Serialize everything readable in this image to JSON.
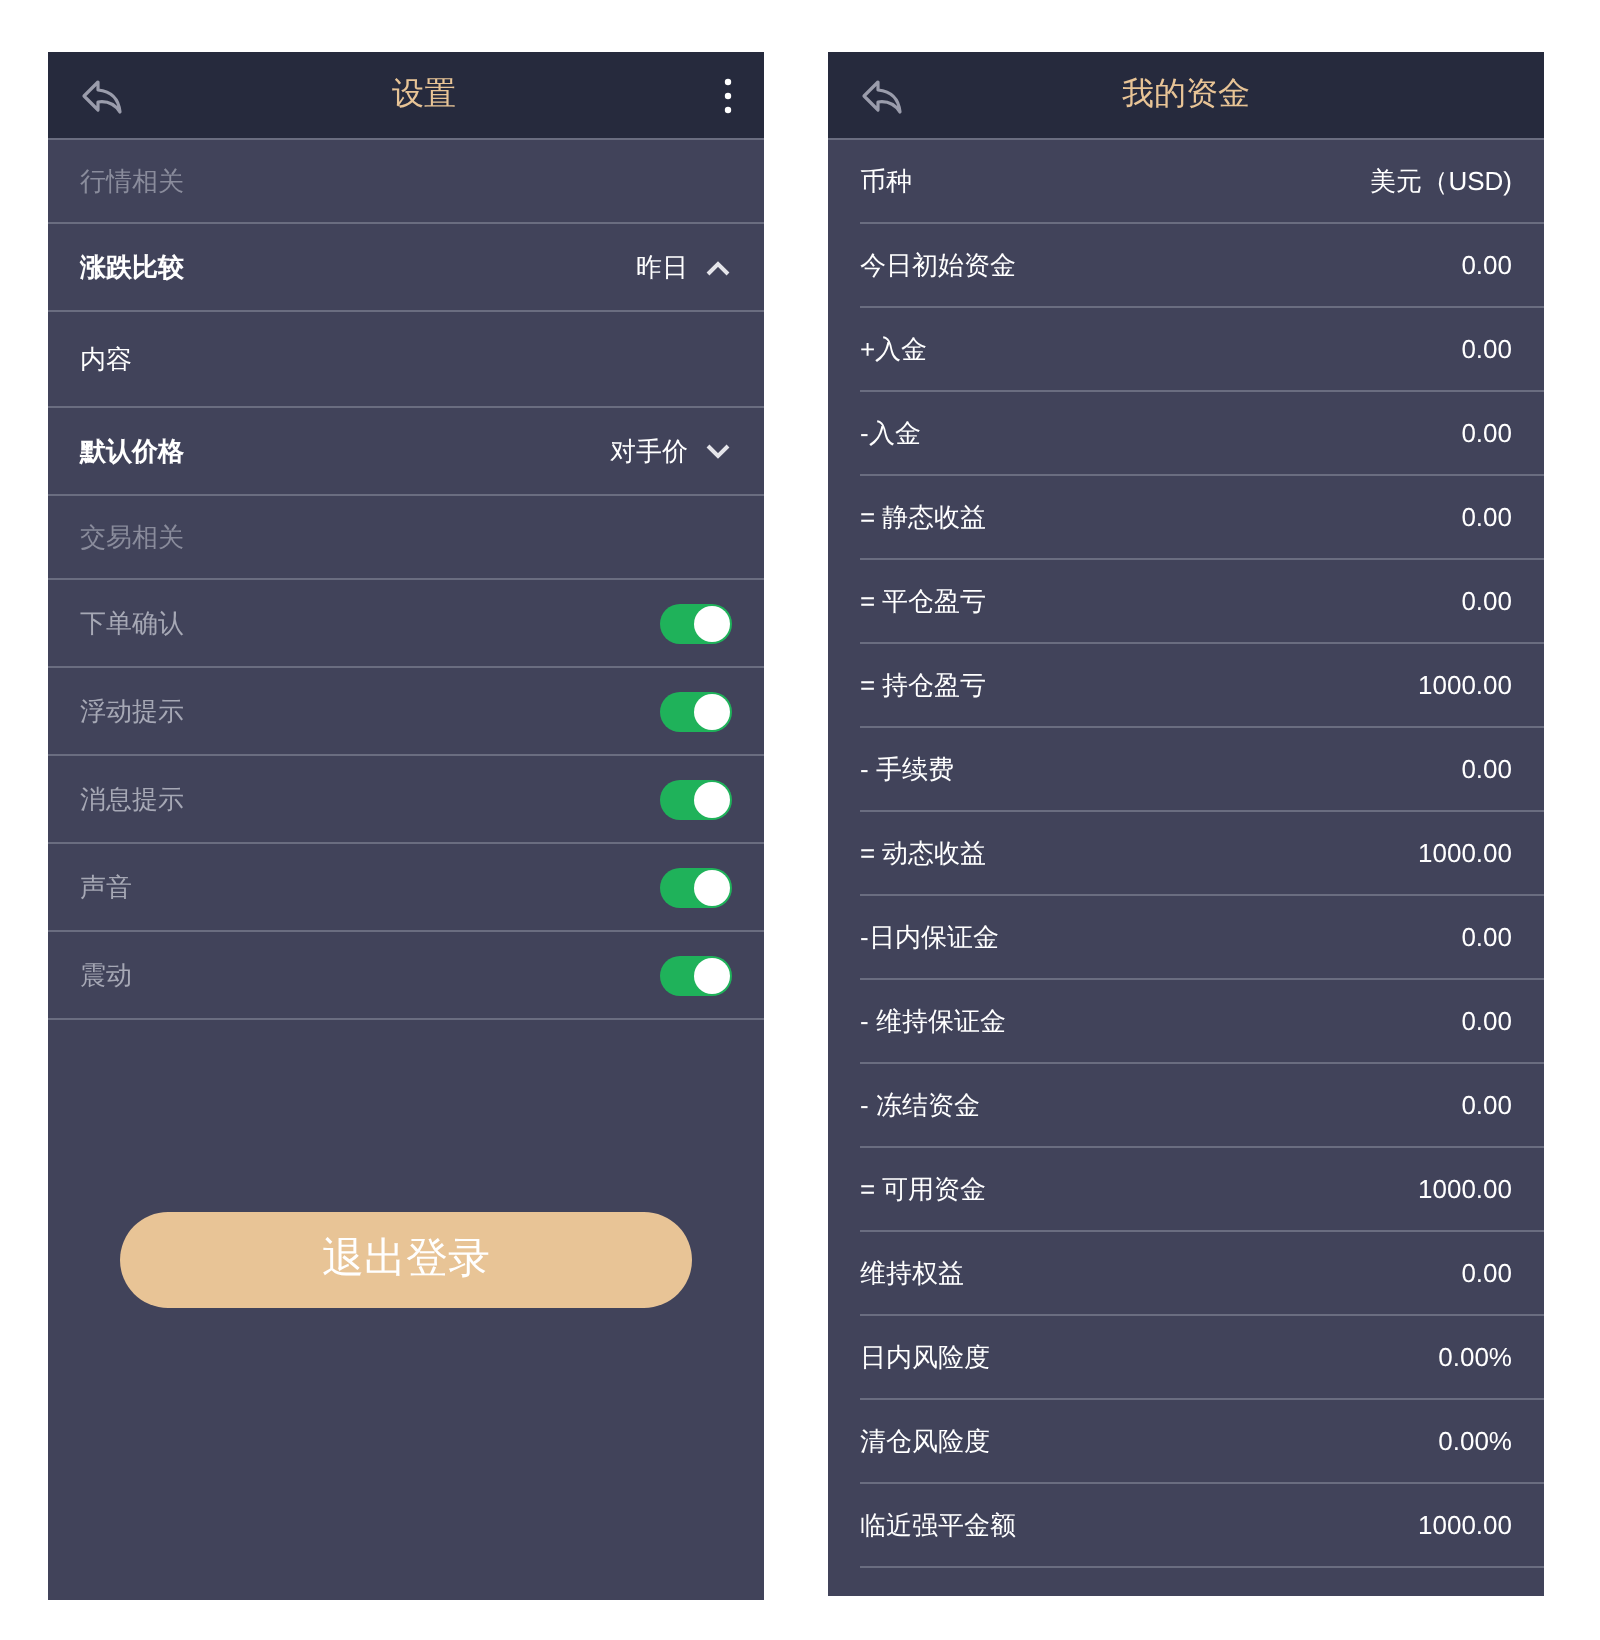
{
  "settings": {
    "title": "设置",
    "items": [
      {
        "kind": "section",
        "label": "行情相关"
      },
      {
        "kind": "select",
        "label": "涨跌比较",
        "value": "昨日",
        "expanded": true
      },
      {
        "kind": "plain",
        "label": "内容"
      },
      {
        "kind": "select",
        "label": "默认价格",
        "value": "对手价",
        "expanded": false
      },
      {
        "kind": "section",
        "label": "交易相关"
      },
      {
        "kind": "toggle",
        "label": "下单确认",
        "on": true
      },
      {
        "kind": "toggle",
        "label": "浮动提示",
        "on": true
      },
      {
        "kind": "toggle",
        "label": "消息提示",
        "on": true
      },
      {
        "kind": "toggle",
        "label": "声音",
        "on": true
      },
      {
        "kind": "toggle",
        "label": "震动",
        "on": true
      }
    ],
    "logout_button": "退出登录"
  },
  "funds": {
    "title": "我的资金",
    "rows": [
      {
        "label": "币种",
        "value": "美元（USD)"
      },
      {
        "label": "今日初始资金",
        "value": "0.00"
      },
      {
        "label": "+入金",
        "value": "0.00"
      },
      {
        "label": "-入金",
        "value": "0.00"
      },
      {
        "label": "= 静态收益",
        "value": "0.00"
      },
      {
        "label": "= 平仓盈亏",
        "value": "0.00"
      },
      {
        "label": "= 持仓盈亏",
        "value": "1000.00"
      },
      {
        "label": "- 手续费",
        "value": "0.00"
      },
      {
        "label": "= 动态收益",
        "value": "1000.00"
      },
      {
        "label": "-日内保证金",
        "value": "0.00"
      },
      {
        "label": "- 维持保证金",
        "value": "0.00"
      },
      {
        "label": "- 冻结资金",
        "value": "0.00"
      },
      {
        "label": "= 可用资金",
        "value": "1000.00"
      },
      {
        "label": "维持权益",
        "value": "0.00"
      },
      {
        "label": "日内风险度",
        "value": "0.00%"
      },
      {
        "label": "清仓风险度",
        "value": "0.00%"
      },
      {
        "label": "临近强平金额",
        "value": "1000.00"
      }
    ]
  }
}
